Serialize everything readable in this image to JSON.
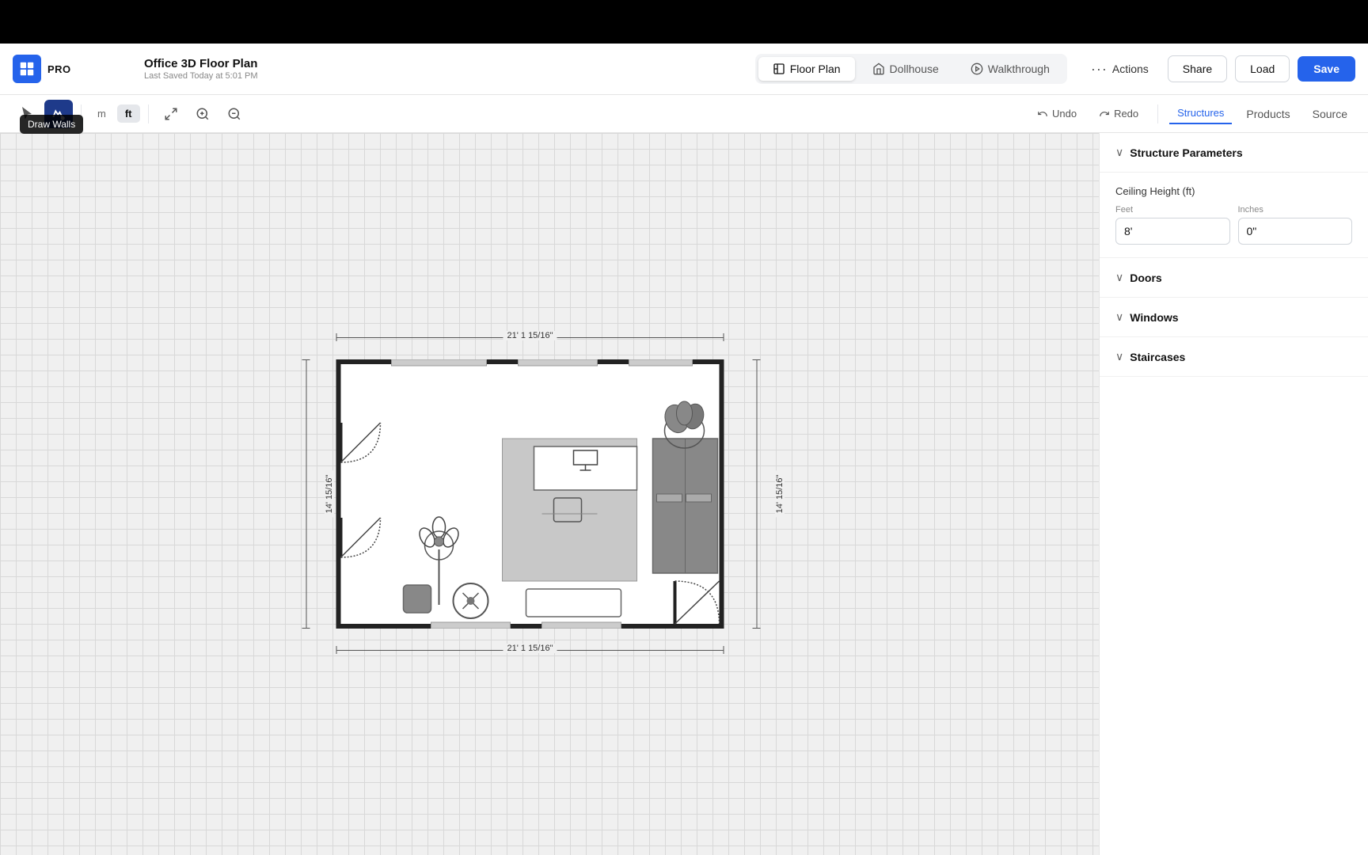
{
  "app": {
    "name": "PRO",
    "logo_text": "PRO"
  },
  "project": {
    "title": "Office 3D Floor Plan",
    "last_saved": "Last Saved Today at 5:01 PM"
  },
  "nav_tabs": [
    {
      "id": "floor-plan",
      "label": "Floor Plan",
      "active": true
    },
    {
      "id": "dollhouse",
      "label": "Dollhouse",
      "active": false
    },
    {
      "id": "walkthrough",
      "label": "Walkthrough",
      "active": false
    }
  ],
  "header_buttons": {
    "actions": "Actions",
    "share": "Share",
    "load": "Load",
    "save": "Save"
  },
  "toolbar": {
    "select_tooltip": "Draw Walls",
    "undo": "Undo",
    "redo": "Redo",
    "unit_m": "m",
    "unit_ft": "ft"
  },
  "panel_tabs": [
    {
      "id": "structures",
      "label": "Structures",
      "active": true
    },
    {
      "id": "products",
      "label": "Products",
      "active": false
    },
    {
      "id": "source",
      "label": "Source",
      "active": false
    }
  ],
  "structure_parameters": {
    "title": "Structure Parameters",
    "ceiling_height": {
      "label": "Ceiling Height (ft)",
      "feet_label": "Feet",
      "feet_value": "8'",
      "inches_label": "Inches",
      "inches_value": "0\""
    }
  },
  "sections": [
    {
      "id": "doors",
      "label": "Doors"
    },
    {
      "id": "windows",
      "label": "Windows"
    },
    {
      "id": "staircases",
      "label": "Staircases"
    }
  ],
  "dimensions": {
    "width": "21' 1 15/16\"",
    "height": "14' 15/16\""
  }
}
